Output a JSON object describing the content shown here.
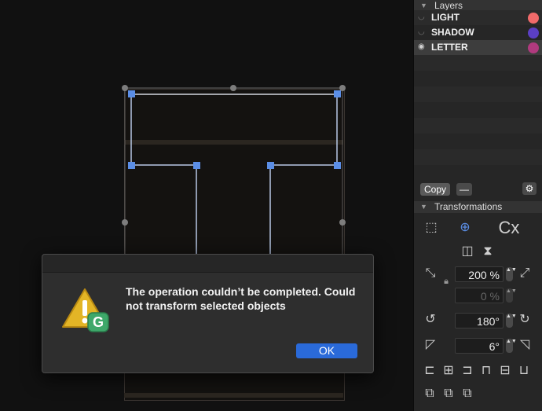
{
  "layers_panel": {
    "title": "Layers",
    "items": [
      {
        "name": "LIGHT",
        "color": "#f06a6a"
      },
      {
        "name": "SHADOW",
        "color": "#5b3fc4"
      },
      {
        "name": "LETTER",
        "color": "#b03a7e"
      }
    ],
    "copy_label": "Copy"
  },
  "transformations": {
    "title": "Transformations",
    "scale_value": "200 %",
    "scale_value2": "0 %",
    "rotate_value": "180°",
    "skew_value": "6°"
  },
  "dialog": {
    "message": "The operation couldn’t be completed. Could not transform selected objects",
    "ok_label": "OK"
  },
  "colors": {
    "accent": "#2a6ad9",
    "handle": "#5b8ee6"
  }
}
